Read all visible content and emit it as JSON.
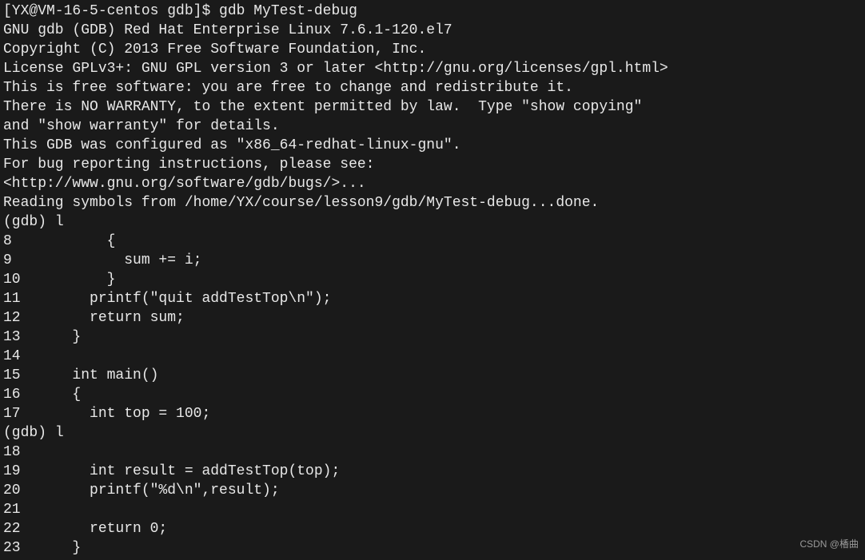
{
  "prompt": {
    "text": "[YX@VM-16-5-centos gdb]$ ",
    "command": "gdb MyTest-debug"
  },
  "output": [
    "GNU gdb (GDB) Red Hat Enterprise Linux 7.6.1-120.el7",
    "Copyright (C) 2013 Free Software Foundation, Inc.",
    "License GPLv3+: GNU GPL version 3 or later <http://gnu.org/licenses/gpl.html>",
    "This is free software: you are free to change and redistribute it.",
    "There is NO WARRANTY, to the extent permitted by law.  Type \"show copying\"",
    "and \"show warranty\" for details.",
    "This GDB was configured as \"x86_64-redhat-linux-gnu\".",
    "For bug reporting instructions, please see:",
    "<http://www.gnu.org/software/gdb/bugs/>...",
    "Reading symbols from /home/YX/course/lesson9/gdb/MyTest-debug...done."
  ],
  "gdb_sessions": [
    {
      "prompt": "(gdb) ",
      "command": "l",
      "lines": [
        "8           {",
        "9             sum += i;",
        "10          }",
        "11        printf(\"quit addTestTop\\n\");",
        "12        return sum;",
        "13      }",
        "14",
        "15      int main()",
        "16      {",
        "17        int top = 100;"
      ]
    },
    {
      "prompt": "(gdb) ",
      "command": "l",
      "lines": [
        "18",
        "19        int result = addTestTop(top);",
        "20        printf(\"%d\\n\",result);",
        "21",
        "22        return 0;",
        "23      }"
      ]
    }
  ],
  "watermark": "CSDN @楿曲"
}
